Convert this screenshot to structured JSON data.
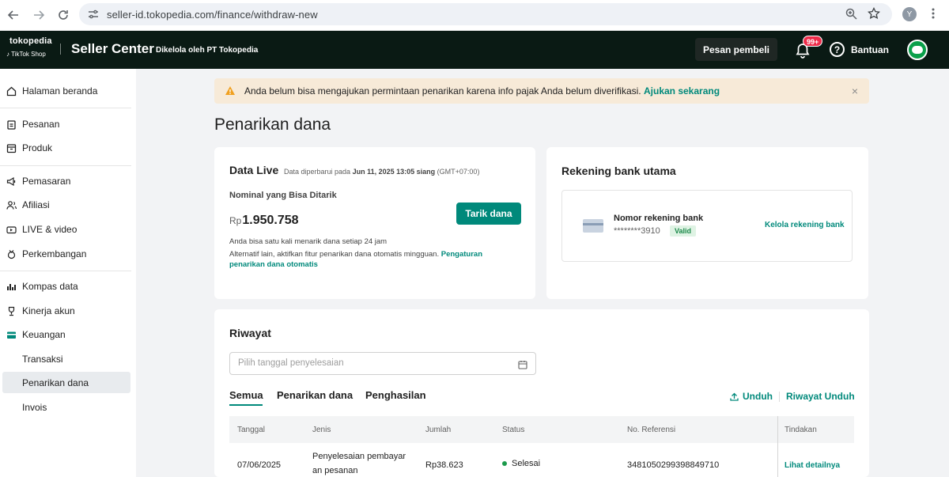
{
  "browser": {
    "url": "seller-id.tokopedia.com/finance/withdraw-new",
    "profile_initial": "Y"
  },
  "header": {
    "logo_top": "tokopedia",
    "logo_bottom": "TikTok Shop",
    "app_name": "Seller Center",
    "managed_by": "Dikelola oleh PT Tokopedia",
    "chat_label": "Pesan pembeli",
    "notif_badge": "99+",
    "help_label": "Bantuan"
  },
  "sidebar": {
    "items": [
      {
        "label": "Halaman beranda",
        "icon": "home-icon"
      },
      {
        "label": "Pesanan",
        "icon": "clipboard-icon"
      },
      {
        "label": "Produk",
        "icon": "box-icon"
      },
      {
        "label": "Pemasaran",
        "icon": "megaphone-icon"
      },
      {
        "label": "Afiliasi",
        "icon": "people-icon"
      },
      {
        "label": "LIVE & video",
        "icon": "video-icon"
      },
      {
        "label": "Perkembangan",
        "icon": "growth-icon"
      },
      {
        "label": "Kompas data",
        "icon": "chart-icon"
      },
      {
        "label": "Kinerja akun",
        "icon": "trophy-icon"
      },
      {
        "label": "Keuangan",
        "icon": "wallet-icon"
      }
    ],
    "sub_items": [
      "Transaksi",
      "Penarikan dana",
      "Invois"
    ]
  },
  "alert": {
    "text": "Anda belum bisa mengajukan permintaan penarikan karena info pajak Anda belum diverifikasi.",
    "link": "Ajukan sekarang",
    "close": "×"
  },
  "page_title": "Penarikan dana",
  "live": {
    "title": "Data Live",
    "updated_prefix": "Data diperbarui pada",
    "updated_time": "Jun 11, 2025 13:05 siang",
    "updated_tz": "(GMT+07:00)",
    "nominal_label": "Nominal yang Bisa Ditarik",
    "currency": "Rp",
    "amount": "1.950.758",
    "withdraw_button": "Tarik dana",
    "note_1": "Anda bisa satu kali menarik dana setiap 24 jam",
    "note_2": "Alternatif lain, aktifkan fitur penarikan dana otomatis mingguan.",
    "note_link_1": "Pengaturan",
    "note_link_2": "penarikan dana otomatis"
  },
  "bank": {
    "title": "Rekening bank utama",
    "label": "Nomor rekening bank",
    "number": "********3910",
    "status": "Valid",
    "manage": "Kelola rekening bank"
  },
  "history": {
    "title": "Riwayat",
    "date_placeholder": "Pilih tanggal penyelesaian",
    "tabs": [
      "Semua",
      "Penarikan dana",
      "Penghasilan"
    ],
    "download": "Unduh",
    "download_history": "Riwayat Unduh",
    "columns": [
      "Tanggal",
      "Jenis",
      "Jumlah",
      "Status",
      "No. Referensi",
      "Tindakan"
    ],
    "rows": [
      {
        "date": "07/06/2025",
        "type_line1": "Penyelesaian pembayar",
        "type_line2": "an pesanan",
        "amount": "Rp38.623",
        "status": "Selesai",
        "reference": "3481050299398849710",
        "action": "Lihat detailnya"
      }
    ]
  },
  "colors": {
    "accent": "#00897b",
    "header_bg": "#0a1a14",
    "alert_bg": "#f7ead8",
    "status_green": "#1b9a4b"
  }
}
